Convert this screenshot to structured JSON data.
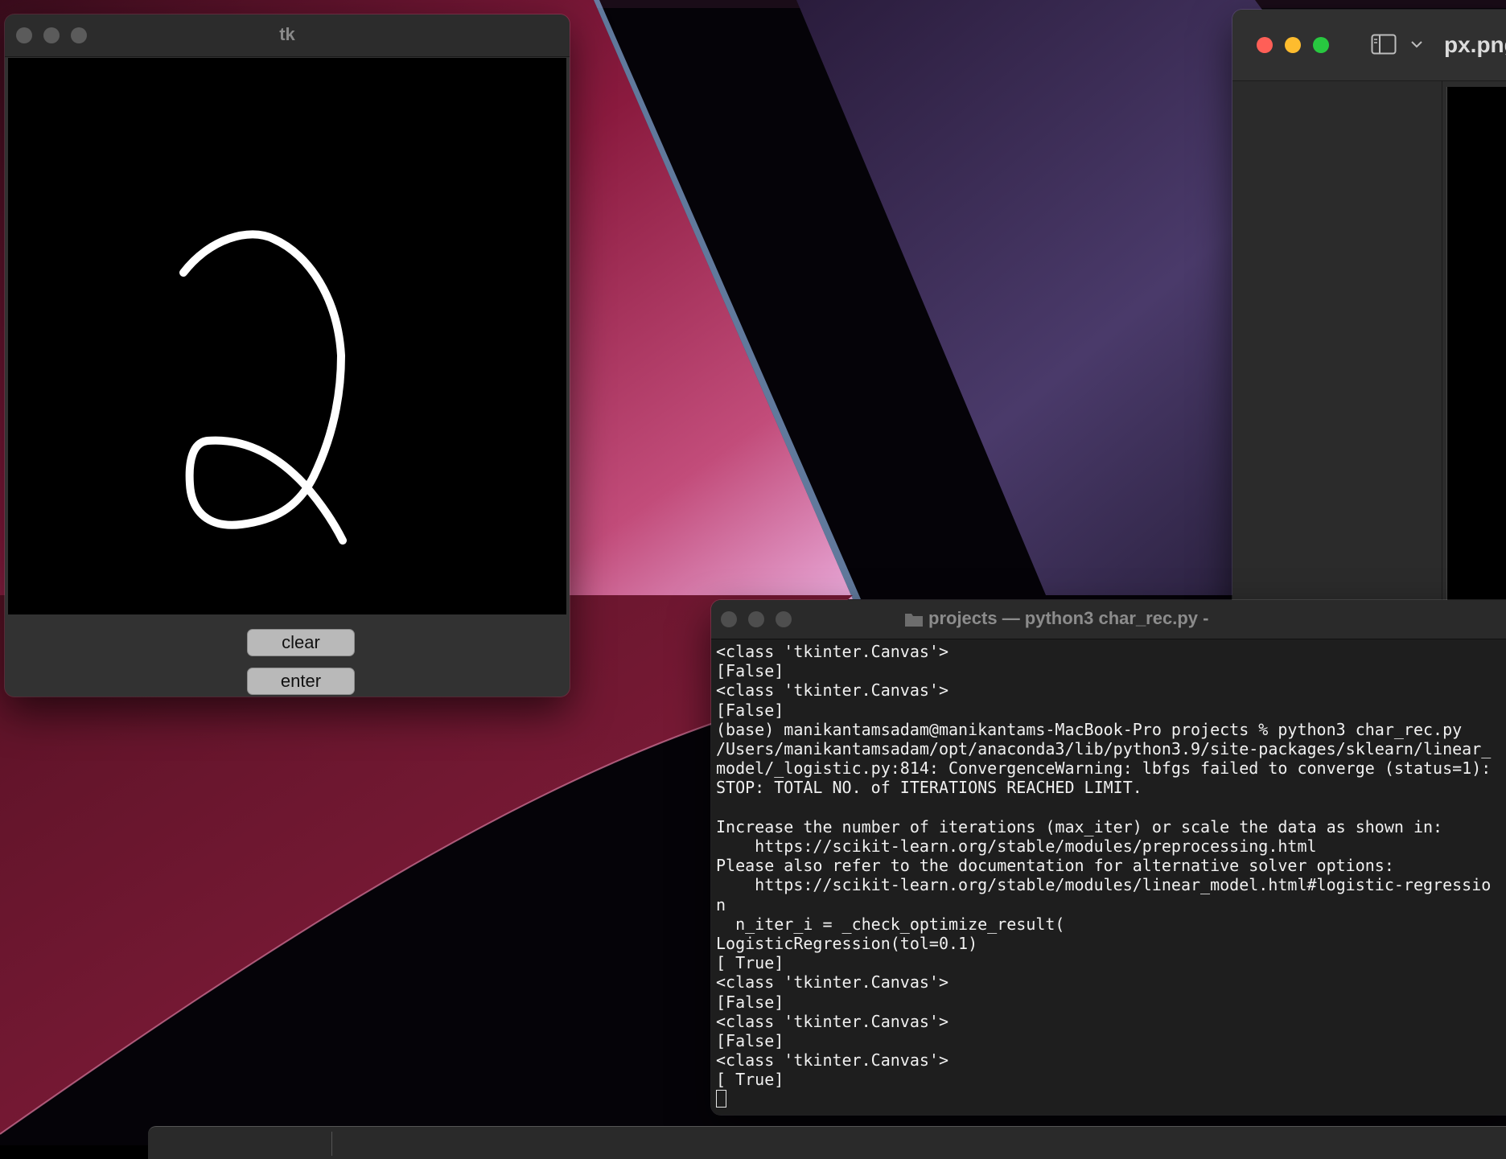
{
  "tk_window": {
    "title": "tk",
    "buttons": {
      "clear": "clear",
      "enter": "enter"
    }
  },
  "preview_window": {
    "title": "px.png"
  },
  "terminal": {
    "title": "projects — python3 char_rec.py -",
    "lines": [
      "<class 'tkinter.Canvas'>",
      "[False]",
      "<class 'tkinter.Canvas'>",
      "[False]",
      "(base) manikantamsadam@manikantams-MacBook-Pro projects % python3 char_rec.py",
      "/Users/manikantamsadam/opt/anaconda3/lib/python3.9/site-packages/sklearn/linear_",
      "model/_logistic.py:814: ConvergenceWarning: lbfgs failed to converge (status=1):",
      "STOP: TOTAL NO. of ITERATIONS REACHED LIMIT.",
      "",
      "Increase the number of iterations (max_iter) or scale the data as shown in:",
      "    https://scikit-learn.org/stable/modules/preprocessing.html",
      "Please also refer to the documentation for alternative solver options:",
      "    https://scikit-learn.org/stable/modules/linear_model.html#logistic-regressio",
      "n",
      "  n_iter_i = _check_optimize_result(",
      "LogisticRegression(tol=0.1)",
      "[ True]",
      "<class 'tkinter.Canvas'>",
      "[False]",
      "<class 'tkinter.Canvas'>",
      "[False]",
      "<class 'tkinter.Canvas'>",
      "[ True]"
    ]
  },
  "colors": {
    "terminal_bg": "#1e1e1e",
    "close_red": "#ff5f57",
    "minimize_yellow": "#febc2e",
    "zoom_green": "#28c840"
  },
  "icons": [
    "sidebar-toggle-icon",
    "chevron-down-icon",
    "folder-icon"
  ]
}
